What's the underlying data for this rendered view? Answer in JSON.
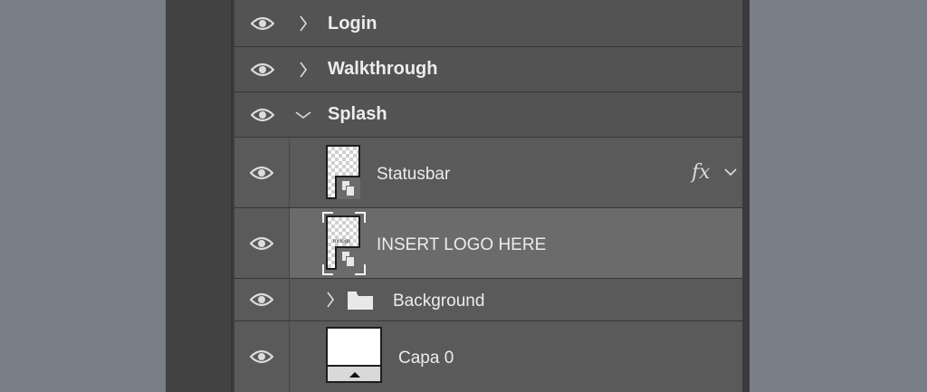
{
  "layers": [
    {
      "kind": "group",
      "label": "Login",
      "expanded": false
    },
    {
      "kind": "group",
      "label": "Walkthrough",
      "expanded": false
    },
    {
      "kind": "group",
      "label": "Splash",
      "expanded": true
    },
    {
      "kind": "layer",
      "label": "Statusbar",
      "effects": "fx",
      "thumb": "smart-object"
    },
    {
      "kind": "layer",
      "label": "INSERT LOGO HERE",
      "selected": true,
      "thumb": "smart-object",
      "thumb_text": "mi logo"
    },
    {
      "kind": "group",
      "label": "Background",
      "expanded": false,
      "icon": "folder-icon"
    },
    {
      "kind": "layer",
      "label": "Capa 0",
      "thumb": "artboard"
    }
  ],
  "colors": {
    "background": "#7a7e87",
    "panel": "#3e3e3e",
    "group_row": "#535353",
    "layer_row": "#5a5a5a",
    "selected_row": "#6b6b6b",
    "text": "#ececec"
  }
}
